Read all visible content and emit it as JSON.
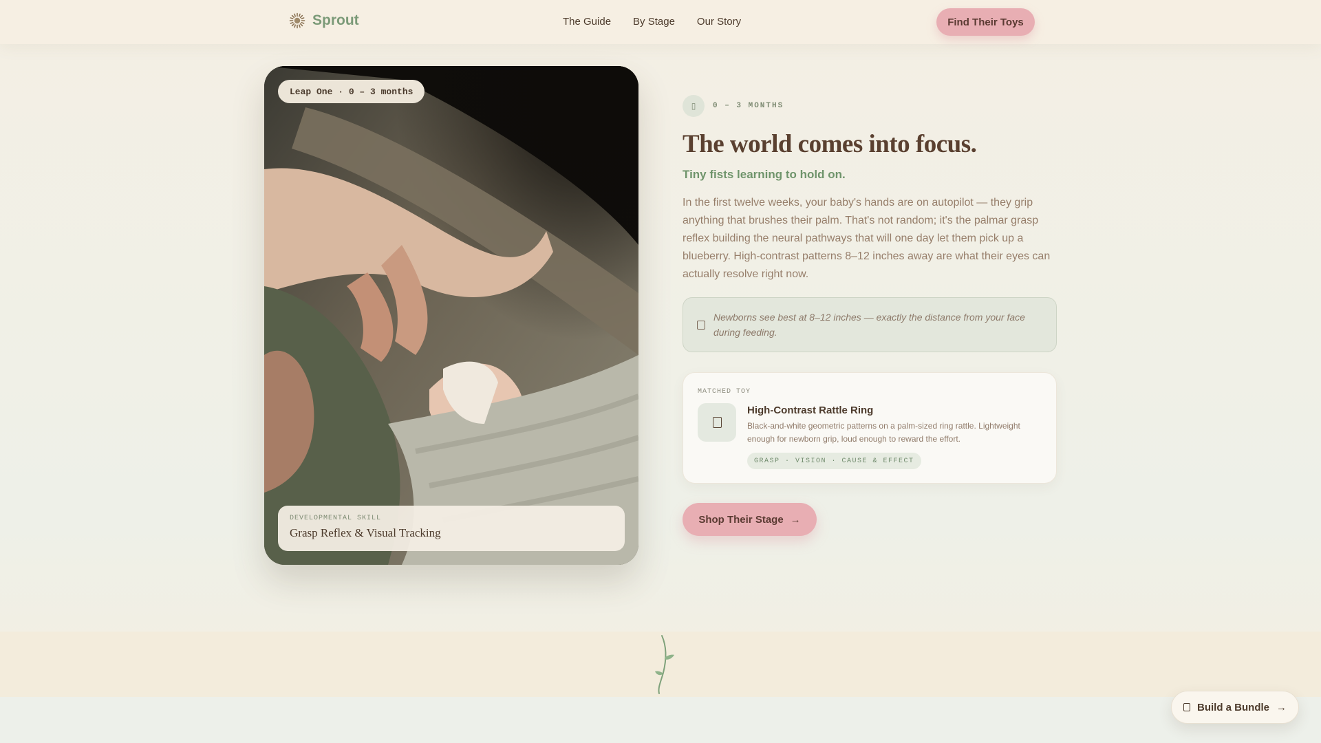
{
  "nav": {
    "brand": "Sprout",
    "links": [
      "The Guide",
      "By Stage",
      "Our Story"
    ],
    "cta": "Find Their Toys"
  },
  "photo": {
    "badge": "Leap One · 0 – 3 months",
    "skill_kicker": "DEVELOPMENTAL SKILL",
    "skill_title": "Grasp Reflex & Visual Tracking"
  },
  "stage": {
    "label": "0 – 3 MONTHS",
    "headline": "The world comes into focus.",
    "subhead": "Tiny fists learning to hold on.",
    "body": "In the first twelve weeks, your baby's hands are on autopilot — they grip anything that brushes their palm. That's not random; it's the palmar grasp reflex building the neural pathways that will one day let them pick up a blueberry. High-contrast patterns 8–12 inches away are what their eyes can actually resolve right now.",
    "tip": "Newborns see best at 8–12 inches — exactly the distance from your face during feeding."
  },
  "toy": {
    "kicker": "MATCHED TOY",
    "name": "High-Contrast Rattle Ring",
    "description": "Black-and-white geometric patterns on a palm-sized ring rattle. Lightweight enough for newborn grip, loud enough to reward the effort.",
    "tags": "GRASP · VISION · CAUSE & EFFECT"
  },
  "actions": {
    "shop": "Shop Their Stage",
    "bundle": "Build a Bundle"
  },
  "colors": {
    "brand_green": "#7b9a78",
    "accent_pink": "#e8aeb3",
    "cream": "#f6efe3"
  }
}
